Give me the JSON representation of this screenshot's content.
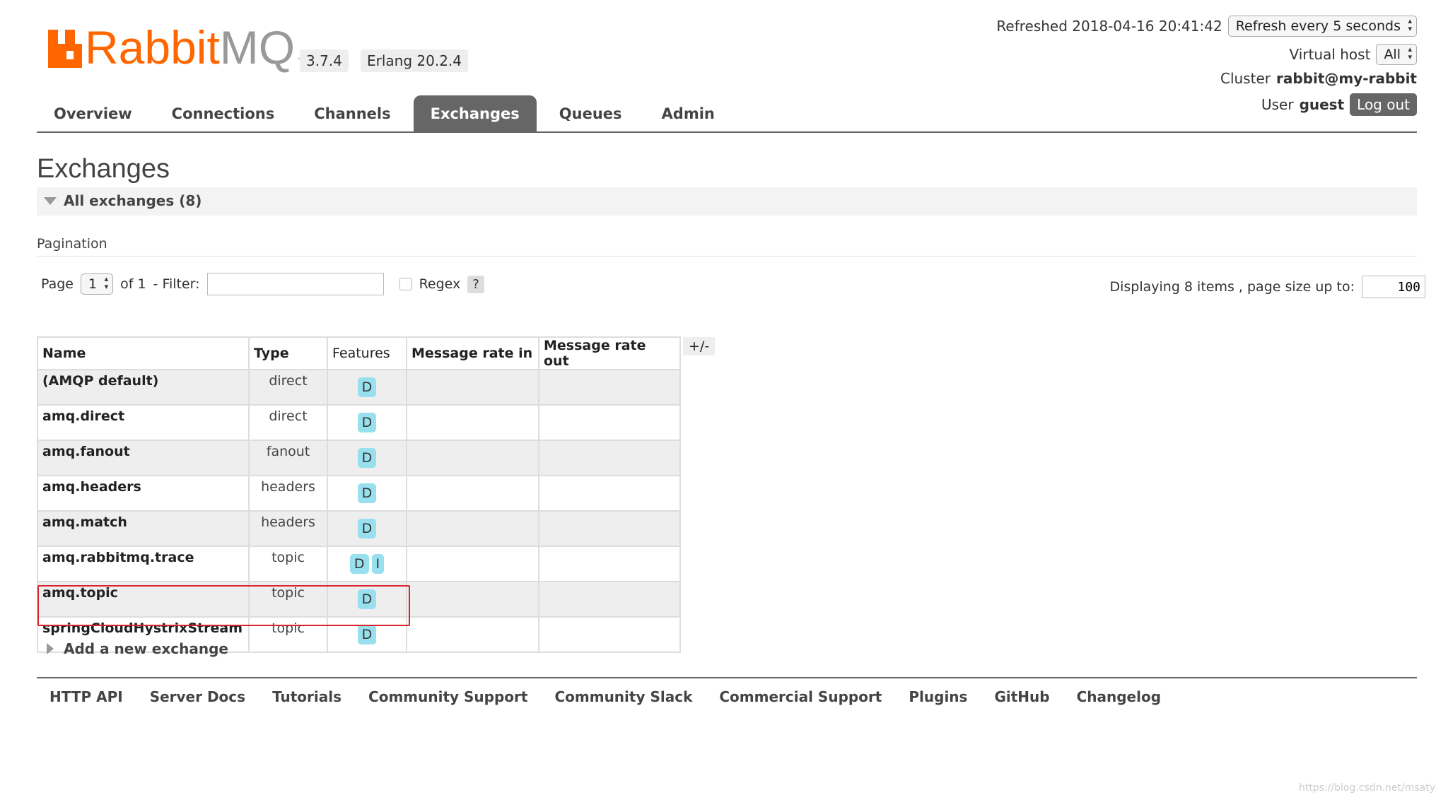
{
  "header": {
    "logo_rabbit": "Rabbit",
    "logo_mq": "MQ",
    "logo_tm": "™",
    "version": "3.7.4",
    "erlang": "Erlang 20.2.4",
    "refreshed_label": "Refreshed 2018-04-16 20:41:42",
    "refresh_select": "Refresh every 5 seconds",
    "vhost_label": "Virtual host",
    "vhost_select": "All",
    "cluster_label": "Cluster",
    "cluster_value": "rabbit@my-rabbit",
    "user_label": "User",
    "user_value": "guest",
    "logout_label": "Log out"
  },
  "tabs": [
    {
      "label": "Overview"
    },
    {
      "label": "Connections"
    },
    {
      "label": "Channels"
    },
    {
      "label": "Exchanges",
      "active": true
    },
    {
      "label": "Queues"
    },
    {
      "label": "Admin"
    }
  ],
  "page": {
    "title": "Exchanges",
    "section_label": "All exchanges (8)"
  },
  "pagination": {
    "title": "Pagination",
    "page_label": "Page",
    "page_select": "1",
    "of_label": "of 1",
    "filter_label": "- Filter:",
    "filter_value": "",
    "regex_label": "Regex",
    "help_label": "?",
    "display_label": "Displaying 8 items , page size up to:",
    "page_size": "100"
  },
  "table": {
    "headers": {
      "name": "Name",
      "type": "Type",
      "features": "Features",
      "rate_in": "Message rate in",
      "rate_out": "Message rate out"
    },
    "col_toggle": "+/-",
    "rows": [
      {
        "name": "(AMQP default)",
        "type": "direct",
        "features": [
          "D"
        ]
      },
      {
        "name": "amq.direct",
        "type": "direct",
        "features": [
          "D"
        ]
      },
      {
        "name": "amq.fanout",
        "type": "fanout",
        "features": [
          "D"
        ]
      },
      {
        "name": "amq.headers",
        "type": "headers",
        "features": [
          "D"
        ]
      },
      {
        "name": "amq.match",
        "type": "headers",
        "features": [
          "D"
        ]
      },
      {
        "name": "amq.rabbitmq.trace",
        "type": "topic",
        "features": [
          "D",
          "I"
        ]
      },
      {
        "name": "amq.topic",
        "type": "topic",
        "features": [
          "D"
        ]
      },
      {
        "name": "springCloudHystrixStream",
        "type": "topic",
        "features": [
          "D"
        ]
      }
    ]
  },
  "add_exchange_label": "Add a new exchange",
  "footer": [
    {
      "label": "HTTP API"
    },
    {
      "label": "Server Docs"
    },
    {
      "label": "Tutorials"
    },
    {
      "label": "Community Support"
    },
    {
      "label": "Community Slack"
    },
    {
      "label": "Commercial Support"
    },
    {
      "label": "Plugins"
    },
    {
      "label": "GitHub"
    },
    {
      "label": "Changelog"
    }
  ],
  "watermark": "https://blog.csdn.net/msaty",
  "colors": {
    "brand_orange": "#ff6600",
    "tab_active": "#666666",
    "feature_badge": "#99e0ee",
    "highlight_red": "#d9232d"
  }
}
